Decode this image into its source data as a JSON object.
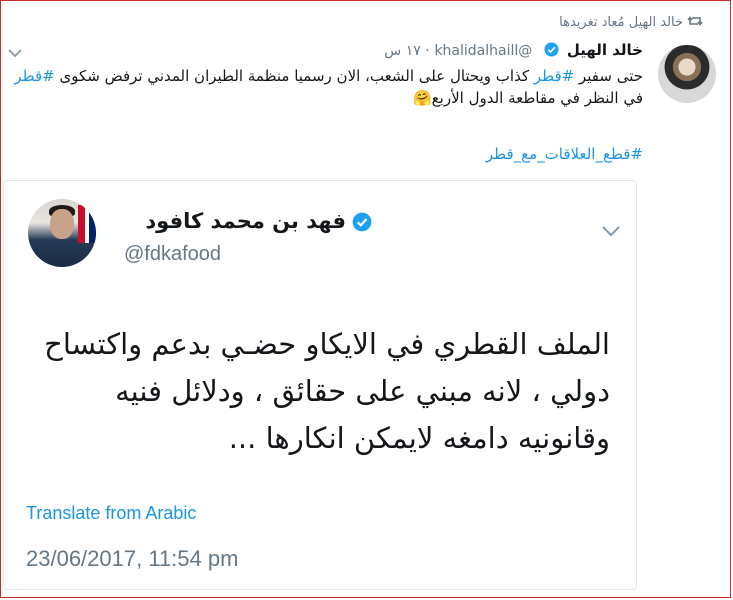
{
  "retweet_context": {
    "text": "خالد الهيل مُعاد تغريدها",
    "icon": "retweet-icon"
  },
  "tweet": {
    "author_name": "خالد الهيل",
    "handle": "@khalidalhaill",
    "time": "١٧ س",
    "text_part1": "حتى سفير ",
    "tag1": "#قطر",
    "text_part2": " كذاب ويحتال على الشعب، الان رسميا منظمة الطيران المدني ترفض شكوى ",
    "tag2": "#قطر",
    "text_part3": " في النظر في مقاطعة الدول الأربع",
    "emoji": "🤗",
    "hashtag": "#قطع_العلاقات_مع_قطر"
  },
  "quote": {
    "author_name": "فهد بن محمد كافود",
    "handle": "@fdkafood",
    "text": "الملف القطري في الايكاو حضـي بدعم واكتساح دولي ، لانه مبني على حقائق ، ودلائل فنيه وقانونيه دامغه لايمكن انكارها ...",
    "translate_label": "Translate from Arabic",
    "date": "23/06/2017, 11:54 pm"
  },
  "colors": {
    "link": "#1b95e0",
    "muted": "#657786",
    "text": "#14171a",
    "border": "#e1e8ed",
    "frame": "#c62d2d"
  }
}
